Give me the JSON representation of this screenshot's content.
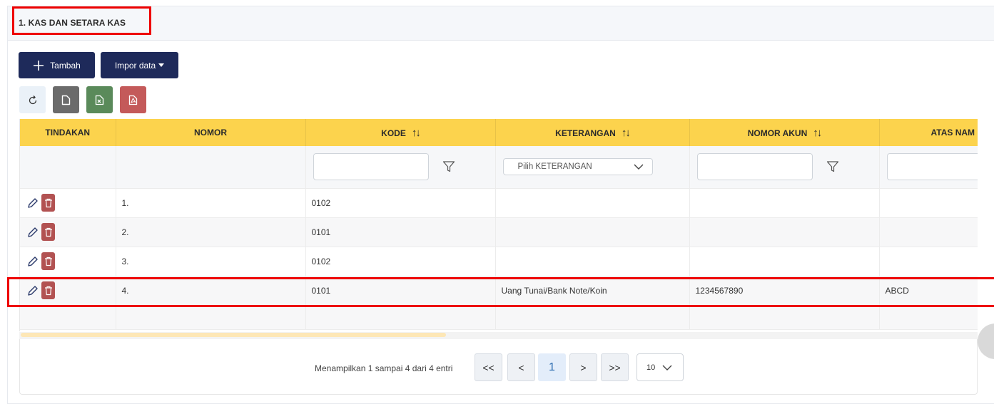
{
  "panel": {
    "title": "1. KAS DAN SETARA KAS"
  },
  "toolbar": {
    "add_label": "Tambah",
    "import_label": "Impor data"
  },
  "icons": {
    "refresh": "refresh-icon",
    "file": "file-icon",
    "excel": "excel-icon",
    "pdf": "pdf-icon"
  },
  "colors": {
    "navy": "#1e2a5a",
    "header_yellow": "#fcd34d",
    "excel_green": "#5a8a5a",
    "pdf_red": "#c45a5a",
    "file_gray": "#6b6b6b",
    "highlight_red": "#ee0000"
  },
  "table": {
    "columns": [
      "TINDAKAN",
      "NOMOR",
      "KODE",
      "KETERANGAN",
      "NOMOR AKUN",
      "ATAS NAM"
    ],
    "select_placeholder": "Pilih KETERANGAN",
    "rows": [
      {
        "nomor": "1.",
        "kode": "0102",
        "keterangan": "",
        "nomor_akun": "",
        "atas_nama": ""
      },
      {
        "nomor": "2.",
        "kode": "0101",
        "keterangan": "",
        "nomor_akun": "",
        "atas_nama": ""
      },
      {
        "nomor": "3.",
        "kode": "0102",
        "keterangan": "",
        "nomor_akun": "",
        "atas_nama": ""
      },
      {
        "nomor": "4.",
        "kode": "0101",
        "keterangan": "Uang Tunai/Bank Note/Koin",
        "nomor_akun": "1234567890",
        "atas_nama": "ABCD"
      }
    ]
  },
  "pager": {
    "info": "Menampilkan 1 sampai 4 dari 4 entri",
    "first": "<<",
    "prev": "<",
    "current": "1",
    "next": ">",
    "last": ">>",
    "page_size": "10"
  }
}
